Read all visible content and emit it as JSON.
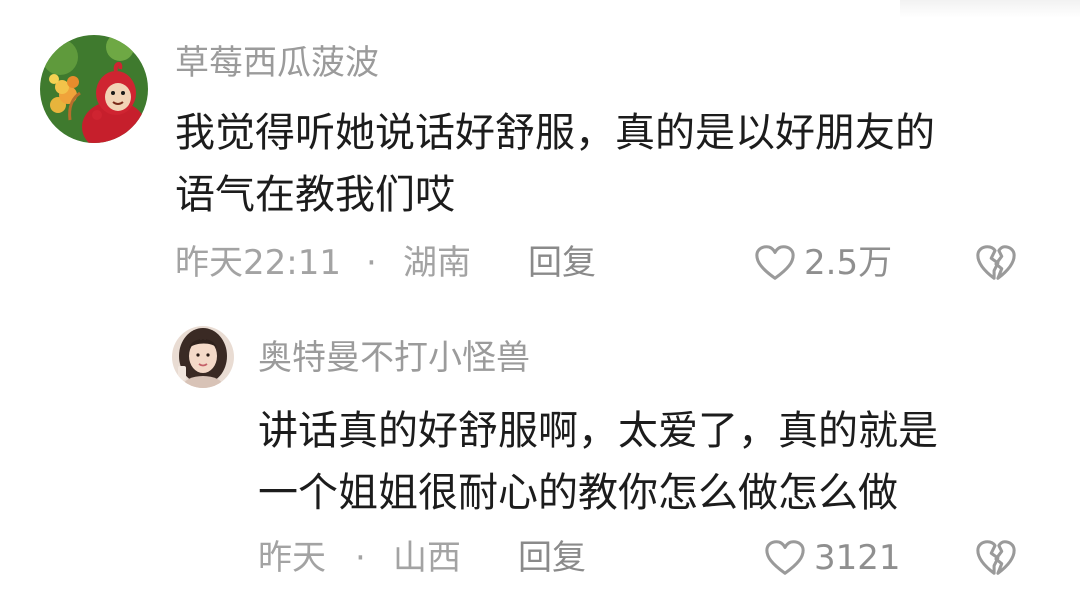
{
  "comments": [
    {
      "username": "草莓西瓜菠波",
      "text_lines": [
        "我觉得听她说话好舒服，真的是以好朋友的",
        "语气在教我们哎"
      ],
      "time": "昨天22:11",
      "separator": "·",
      "location": "湖南",
      "reply_label": "回复",
      "like_count": "2.5万",
      "avatar_icon": "teletubby-avatar",
      "like_icon": "heart-outline-icon",
      "dislike_icon": "broken-heart-icon"
    },
    {
      "username": "奥特曼不打小怪兽",
      "text_lines": [
        "讲话真的好舒服啊，太爱了，真的就是",
        "一个姐姐很耐心的教你怎么做怎么做"
      ],
      "time": "昨天",
      "separator": "·",
      "location": "山西",
      "reply_label": "回复",
      "like_count": "3121",
      "avatar_icon": "girl-portrait-avatar",
      "like_icon": "heart-outline-icon",
      "dislike_icon": "broken-heart-icon"
    }
  ],
  "colors": {
    "username": "#9b9b9b",
    "text": "#1c1c1c",
    "meta": "#a3a3a3",
    "icon_stroke": "#9a9a9a"
  }
}
